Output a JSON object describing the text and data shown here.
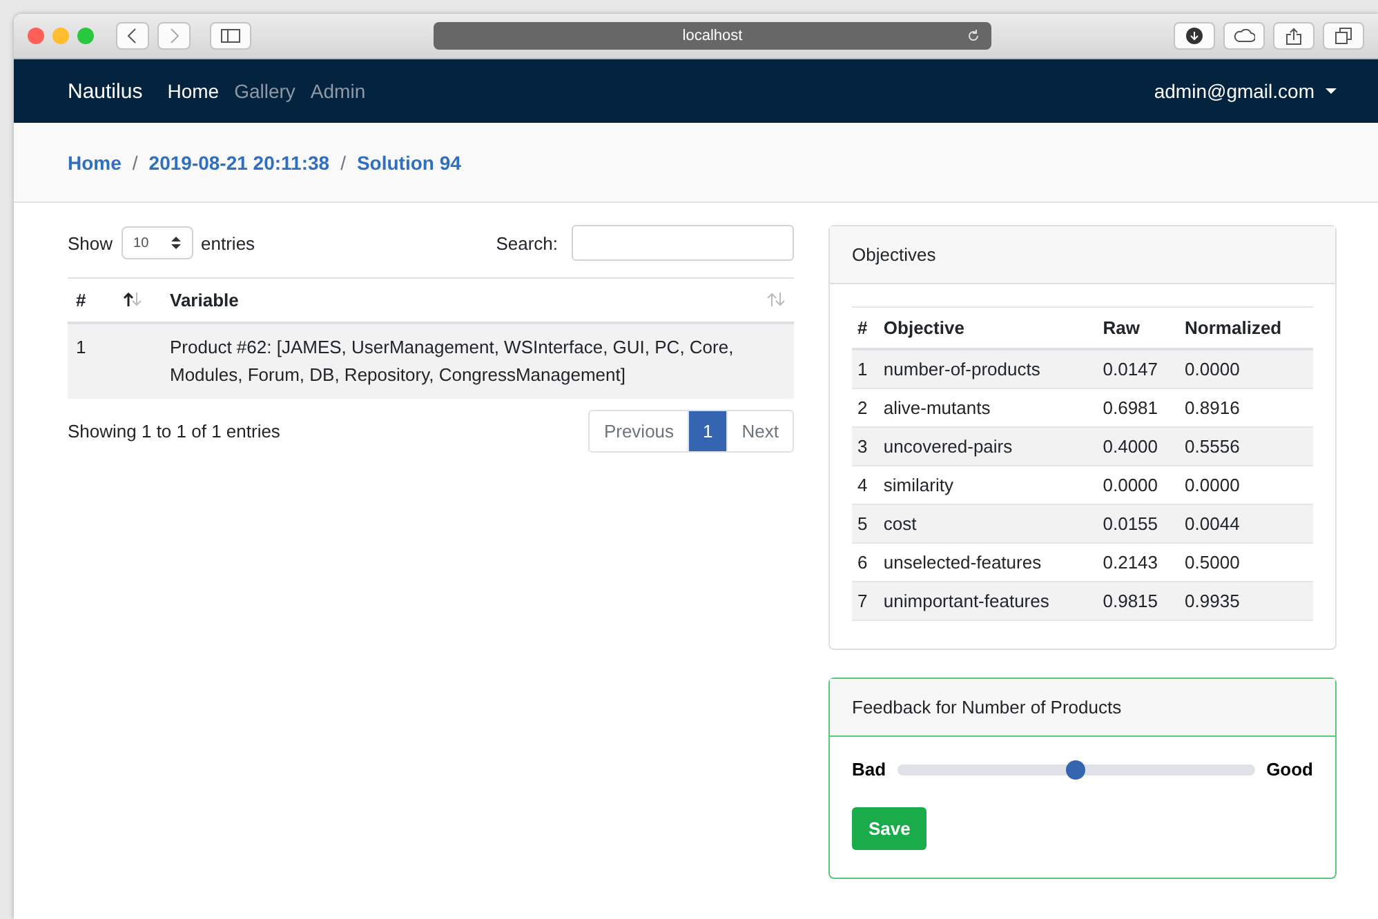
{
  "browser": {
    "address": "localhost"
  },
  "navbar": {
    "brand": "Nautilus",
    "links": [
      {
        "label": "Home",
        "selected": true
      },
      {
        "label": "Gallery",
        "selected": false
      },
      {
        "label": "Admin",
        "selected": false
      }
    ],
    "user": "admin@gmail.com"
  },
  "breadcrumb": {
    "separator": "/",
    "items": [
      "Home",
      "2019-08-21 20:11:38",
      "Solution 94"
    ]
  },
  "variables": {
    "show_label": "Show",
    "page_size": "10",
    "entries_label": "entries",
    "search_label": "Search:",
    "columns": [
      "#",
      "Variable"
    ],
    "rows": [
      {
        "number": "1",
        "variable": "Product #62: [JAMES, UserManagement, WSInterface, GUI, PC, Core, Modules, Forum, DB, Repository, CongressManagement]"
      }
    ],
    "info": "Showing 1 to 1 of 1 entries",
    "pagination": [
      {
        "label": "Previous",
        "selected": false
      },
      {
        "label": "1",
        "selected": true
      },
      {
        "label": "Next",
        "selected": false
      }
    ]
  },
  "objectives": {
    "title": "Objectives",
    "columns": [
      "#",
      "Objective",
      "Raw",
      "Normalized"
    ],
    "rows": [
      [
        "1",
        "number-of-products",
        "0.0147",
        "0.0000"
      ],
      [
        "2",
        "alive-mutants",
        "0.6981",
        "0.8916"
      ],
      [
        "3",
        "uncovered-pairs",
        "0.4000",
        "0.5556"
      ],
      [
        "4",
        "similarity",
        "0.0000",
        "0.0000"
      ],
      [
        "5",
        "cost",
        "0.0155",
        "0.0044"
      ],
      [
        "6",
        "unselected-features",
        "0.2143",
        "0.5000"
      ],
      [
        "7",
        "unimportant-features",
        "0.9815",
        "0.9935"
      ]
    ]
  },
  "feedback": {
    "title": "Feedback for Number of Products",
    "low_label": "Bad",
    "high_label": "Good",
    "level": 0.5,
    "button": "Save"
  }
}
